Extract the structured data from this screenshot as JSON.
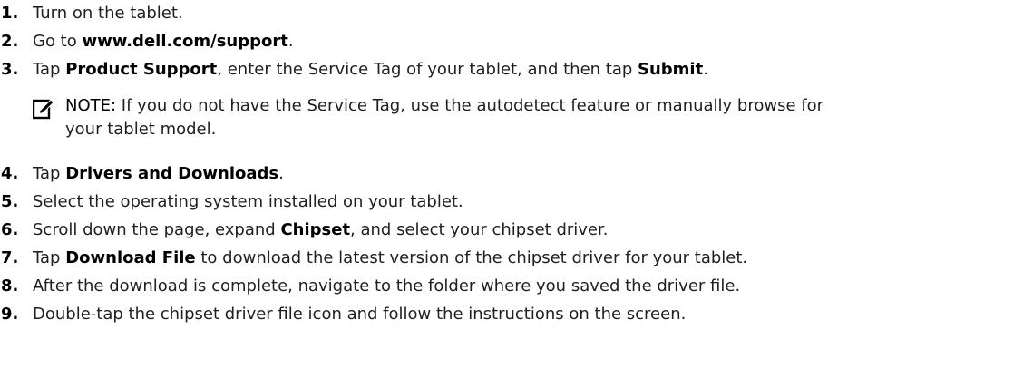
{
  "steps": [
    {
      "num": "1.",
      "parts": [
        "Turn on the tablet."
      ]
    },
    {
      "num": "2.",
      "parts": [
        "Go to ",
        "www.dell.com/support",
        "."
      ]
    },
    {
      "num": "3.",
      "parts": [
        "Tap ",
        "Product Support",
        ", enter the Service Tag of your tablet, and then tap ",
        "Submit",
        "."
      ]
    },
    {
      "num": "4.",
      "parts": [
        "Tap ",
        "Drivers and Downloads",
        "."
      ]
    },
    {
      "num": "5.",
      "parts": [
        "Select the operating system installed on your tablet."
      ]
    },
    {
      "num": "6.",
      "parts": [
        "Scroll down the page, expand ",
        "Chipset",
        ", and select your chipset driver."
      ]
    },
    {
      "num": "7.",
      "parts": [
        "Tap ",
        "Download File",
        " to download the latest version of the chipset driver for your tablet."
      ]
    },
    {
      "num": "8.",
      "parts": [
        "After the download is complete, navigate to the folder where you saved the driver file."
      ]
    },
    {
      "num": "9.",
      "parts": [
        "Double-tap the chipset driver file icon and follow the instructions on the screen."
      ]
    }
  ],
  "note": {
    "icon": "pencil-note-icon",
    "label": "NOTE:",
    "line1": " If you do not have the Service Tag, use the autodetect feature or manually browse for",
    "line2": "your tablet model."
  }
}
